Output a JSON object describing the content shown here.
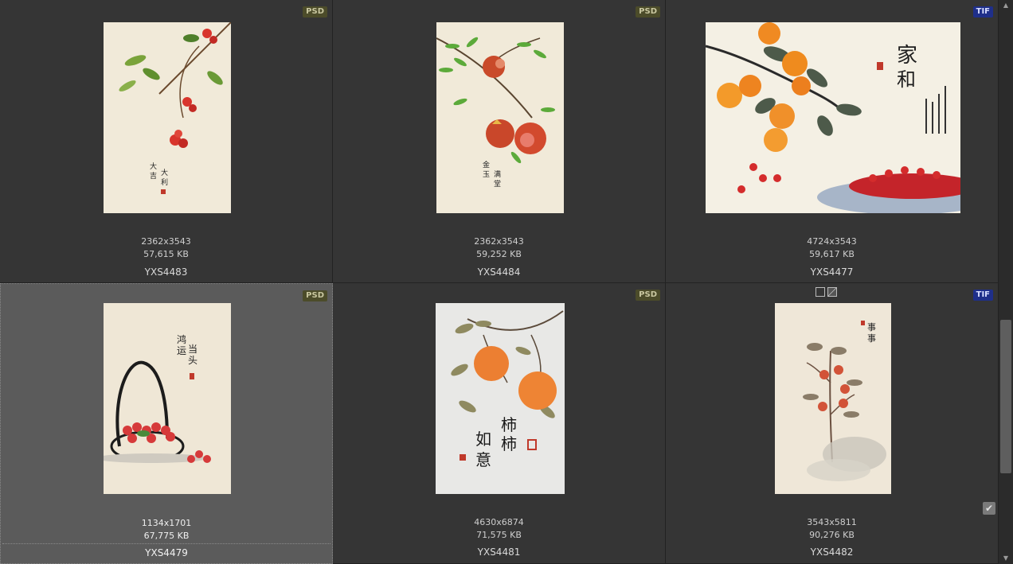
{
  "items": [
    {
      "format": "PSD",
      "dims": "2362x3543",
      "size": "57,615 KB",
      "name": "YXS4483"
    },
    {
      "format": "PSD",
      "dims": "2362x3543",
      "size": "59,252 KB",
      "name": "YXS4484"
    },
    {
      "format": "TIF",
      "dims": "4724x3543",
      "size": "59,617 KB",
      "name": "YXS4477"
    },
    {
      "format": "PSD",
      "dims": "1134x1701",
      "size": "67,775 KB",
      "name": "YXS4479"
    },
    {
      "format": "PSD",
      "dims": "4630x6874",
      "size": "71,575 KB",
      "name": "YXS4481"
    },
    {
      "format": "TIF",
      "dims": "3543x5811",
      "size": "90,276 KB",
      "name": "YXS4482"
    }
  ],
  "selected_index": 3,
  "colors": {
    "psd_badge": "#4c4c2a",
    "tif_badge": "#1f2f8a",
    "selected_bg": "#5b5b5b",
    "cell_bg": "#353535"
  }
}
